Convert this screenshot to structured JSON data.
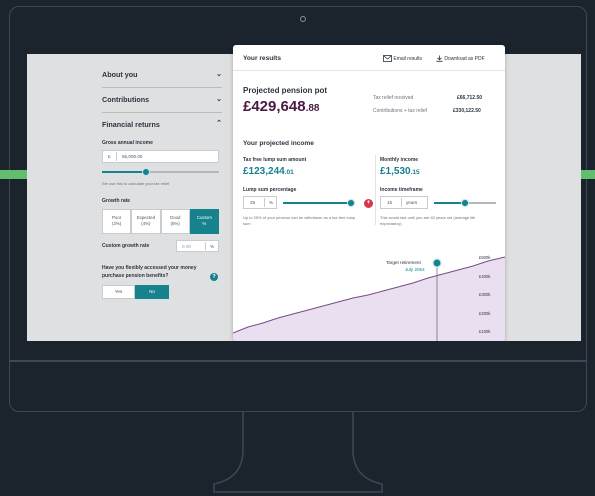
{
  "form": {
    "about_label": "About you",
    "contributions_label": "Contributions",
    "financial_label": "Financial returns",
    "gross_income_label": "Gross annual income",
    "currency_symbol": "£",
    "gross_income_value": "65,000.00",
    "income_hint": "We use this to calculate your tax relief",
    "growth_rate_label": "Growth rate",
    "growth_options": [
      {
        "line1": "Poor",
        "line2": "(2%)"
      },
      {
        "line1": "Expected",
        "line2": "(4%)"
      },
      {
        "line1": "Good",
        "line2": "(6%)"
      },
      {
        "line1": "Custom",
        "line2": "%"
      }
    ],
    "growth_selected_index": 3,
    "income_slider_level": 0.38,
    "custom_rate_label": "Custom growth rate",
    "custom_rate_value": "0.00",
    "percent_symbol": "%",
    "flexi_question": "Have you flexibly accessed your money purchase pension benefits?",
    "yes_label": "Yes",
    "no_label": "No",
    "help_icon_glyph": "?"
  },
  "results": {
    "title": "Your results",
    "email_label": "Email results",
    "pdf_label": "Download as PDF",
    "pot_label": "Projected pension pot",
    "pot_value": "£429,648",
    "pot_pence": ".88",
    "tax_relief_label": "Tax relief received",
    "tax_relief_value": "£66,712.50",
    "contrib_label": "Contributions + tax relief",
    "contrib_value": "£330,122.50",
    "income_heading": "Your projected income",
    "lump_label": "Tax free lump sum amount",
    "lump_value": "£123,244",
    "lump_pence": ".01",
    "monthly_label": "Monthly income",
    "monthly_value": "£1,530",
    "monthly_pence": ".15",
    "lump_pct_label": "Lump sum percentage",
    "lump_pct_value": "25",
    "lump_pct_unit": "%",
    "lump_slider_level": 1.0,
    "lump_hint": "Up to 25% of your pension can be withdrawn as a tax free lump sum",
    "timeframe_label": "Income timeframe",
    "timeframe_value": "15",
    "timeframe_unit": "years",
    "timeframe_slider_level": 0.5,
    "timeframe_hint": "This would last until you are 82 years old (average life expectancy)",
    "target_label": "Target retirement",
    "target_date": "July 2054",
    "chart_ticks": [
      "£500k",
      "£400k",
      "£300k",
      "£200k",
      "£100k"
    ]
  },
  "colors": {
    "teal": "#16828e",
    "plum": "#4a1942",
    "accent_green": "#62bd6e",
    "chart_fill": "#eadff0",
    "chart_line": "#7a4a86",
    "background": "#1b242d"
  }
}
